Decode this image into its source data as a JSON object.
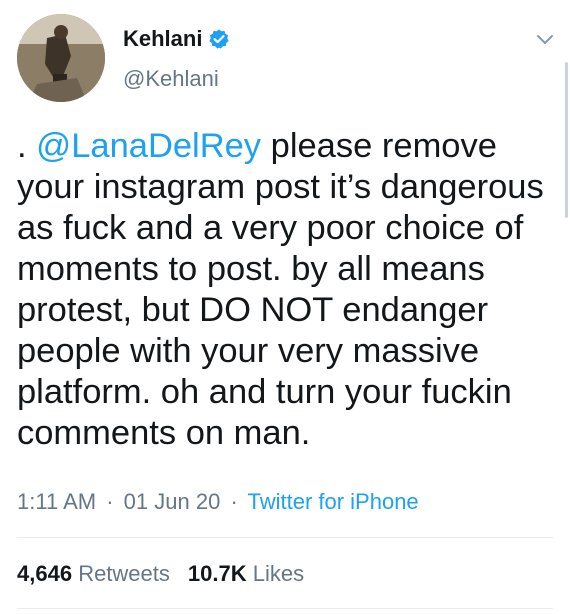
{
  "author": {
    "display_name": "Kehlani",
    "handle": "@Kehlani",
    "verified_icon": "verified-badge-icon"
  },
  "tweet": {
    "prefix": ". ",
    "mention": "@LanaDelRey",
    "body": " please remove your instagram post it’s dangerous as fuck and a very poor choice of moments to post. by all means protest, but DO NOT endanger people with your very massive platform. oh and turn your fuckin comments on man."
  },
  "meta": {
    "time": "1:11 AM",
    "separator": "·",
    "date": "01 Jun 20",
    "source": "Twitter for iPhone"
  },
  "stats": {
    "retweets_count": "4,646",
    "retweets_label": "Retweets",
    "likes_count": "10.7K",
    "likes_label": "Likes"
  },
  "colors": {
    "accent": "#1da1f2",
    "text": "#14171a",
    "muted": "#657786",
    "divider": "#e6ecf0"
  }
}
